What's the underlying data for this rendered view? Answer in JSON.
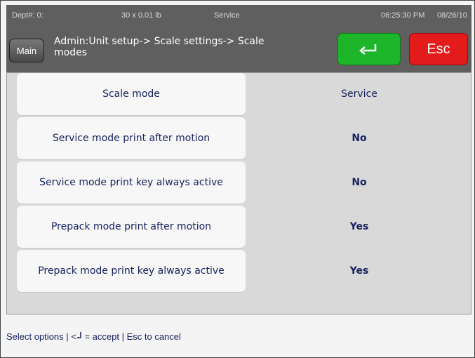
{
  "status_bar": {
    "dept": "Dept#: 0:",
    "capacity": "30 x 0.01 lb",
    "mode": "Service",
    "time": "06:25:30 PM",
    "date": "08/26/10"
  },
  "header": {
    "main_label": "Main",
    "breadcrumb": "Admin:Unit setup-> Scale settings-> Scale modes",
    "enter_icon": "enter-return-icon",
    "esc_label": "Esc"
  },
  "settings": [
    {
      "label": "Scale mode",
      "value": "Service"
    },
    {
      "label": "Service mode print after motion",
      "value": "No"
    },
    {
      "label": "Service mode print key always active",
      "value": "No"
    },
    {
      "label": "Prepack mode print after motion",
      "value": "Yes"
    },
    {
      "label": "Prepack mode print key always active",
      "value": "Yes"
    }
  ],
  "footer": {
    "hint_prefix": "Select options | <",
    "hint_suffix": " = accept | Esc to cancel"
  },
  "colors": {
    "accept": "#1db52a",
    "cancel": "#e41b1b",
    "header_bg": "#5f5f5f",
    "text": "#15215c"
  }
}
